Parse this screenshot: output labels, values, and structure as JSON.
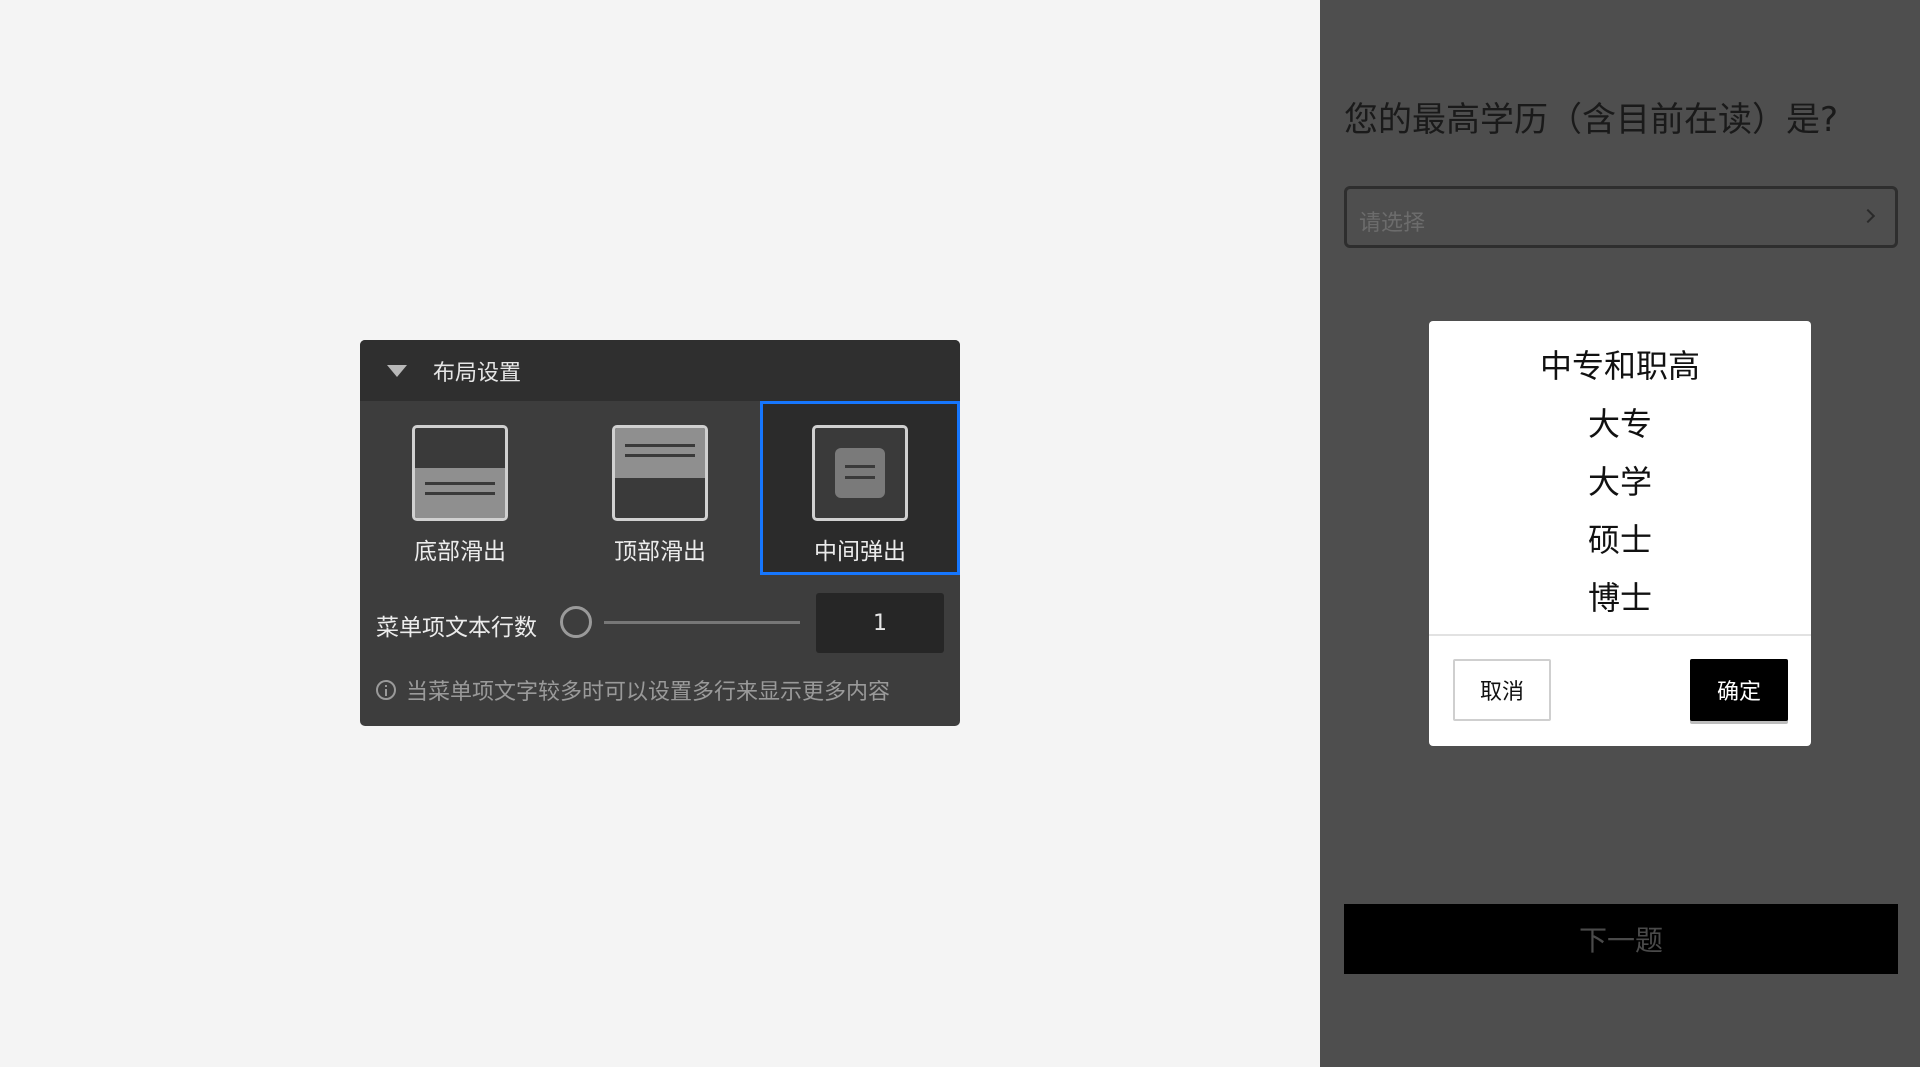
{
  "settings_panel": {
    "title": "布局设置",
    "layout_options": [
      {
        "label": "底部滑出",
        "icon": "bottom-slide-icon",
        "selected": false
      },
      {
        "label": "顶部滑出",
        "icon": "top-slide-icon",
        "selected": false
      },
      {
        "label": "中间弹出",
        "icon": "center-popup-icon",
        "selected": true
      }
    ],
    "menu_lines": {
      "label": "菜单项文本行数",
      "value": "1"
    },
    "hint": "当菜单项文字较多时可以设置多行来显示更多内容"
  },
  "preview": {
    "question": "您的最高学历（含目前在读）是?",
    "select_placeholder": "请选择",
    "modal": {
      "options": [
        "中专和职高",
        "大专",
        "大学",
        "硕士",
        "博士"
      ],
      "cancel_label": "取消",
      "confirm_label": "确定"
    },
    "next_label": "下一题"
  },
  "colors": {
    "accent": "#1677ff",
    "panel_bg": "#3d3d3d",
    "preview_bg": "#4e4e4e"
  }
}
